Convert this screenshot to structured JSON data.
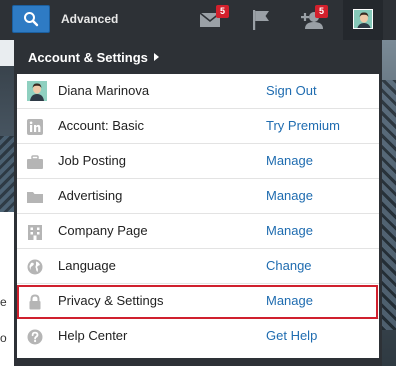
{
  "topnav": {
    "advanced_label": "Advanced",
    "messages_badge": "5",
    "notifications_badge": "5",
    "accent_color": "#2e7bc4",
    "badge_color": "#d3202c"
  },
  "menu": {
    "header": "Account & Settings",
    "items": [
      {
        "icon": "avatar",
        "label": "Diana Marinova",
        "action": "Sign Out"
      },
      {
        "icon": "linkedin-icon",
        "label": "Account: Basic",
        "action": "Try Premium"
      },
      {
        "icon": "briefcase-icon",
        "label": "Job Posting",
        "action": "Manage"
      },
      {
        "icon": "folder-icon",
        "label": "Advertising",
        "action": "Manage"
      },
      {
        "icon": "building-icon",
        "label": "Company Page",
        "action": "Manage"
      },
      {
        "icon": "globe-icon",
        "label": "Language",
        "action": "Change"
      },
      {
        "icon": "lock-icon",
        "label": "Privacy & Settings",
        "action": "Manage",
        "highlighted": true
      },
      {
        "icon": "help-icon",
        "label": "Help Center",
        "action": "Get Help"
      }
    ],
    "highlight_color": "#d0202e",
    "link_color": "#1f6cb0"
  },
  "background": {
    "left_fragments": [
      "e",
      "o"
    ]
  }
}
